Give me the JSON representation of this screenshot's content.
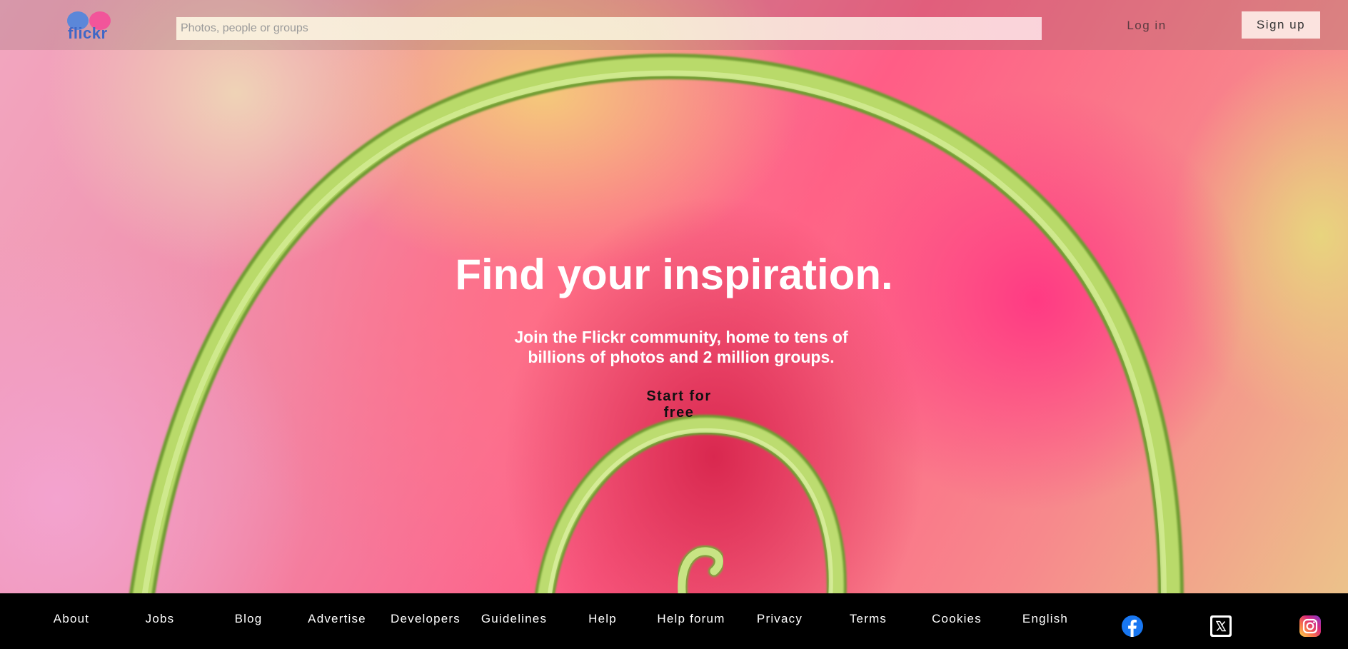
{
  "brand": {
    "logo_text": "flickr",
    "colors": {
      "blue": "#5b87d9",
      "pink": "#f2559a"
    }
  },
  "header": {
    "search_placeholder": "Photos, people or groups",
    "login_label": "Log in",
    "signup_label": "Sign up"
  },
  "hero": {
    "headline": "Find your inspiration.",
    "subline": "Join the Flickr community, home to tens of billions of photos and 2 million groups.",
    "cta_label": "Start for free"
  },
  "footer": {
    "links": [
      "About",
      "Jobs",
      "Blog",
      "Advertise",
      "Developers",
      "Guidelines",
      "Help",
      "Help forum",
      "Privacy",
      "Terms",
      "Cookies",
      "English"
    ],
    "social_icons": [
      "facebook-icon",
      "x-icon",
      "instagram-icon"
    ]
  }
}
